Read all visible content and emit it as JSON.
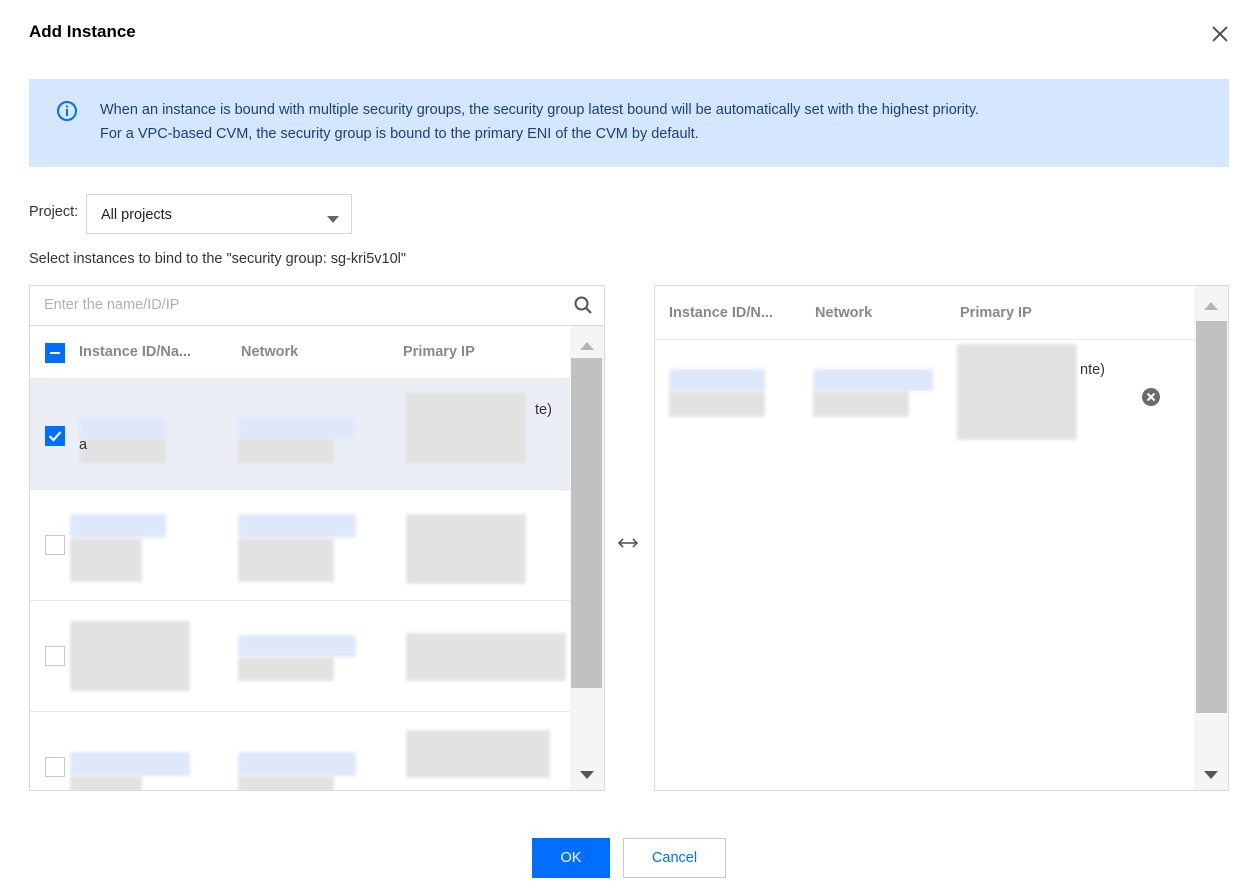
{
  "dialog": {
    "title": "Add Instance"
  },
  "notice": {
    "line1": "When an instance is bound with multiple security groups, the security group latest bound will be automatically set with the highest priority.",
    "line2": "For a VPC-based CVM, the security group is bound to the primary ENI of the CVM by default."
  },
  "project": {
    "label": "Project:",
    "selected": "All projects"
  },
  "instructions": "Select instances to bind to the \"security group: sg-kri5v10l\"",
  "left_panel": {
    "search_placeholder": "Enter the name/ID/IP",
    "columns": [
      "Instance ID/Na...",
      "Network",
      "Primary IP"
    ],
    "rows": [
      {
        "checked": true,
        "ip_suffix": "te)",
        "name_prefix": "a"
      },
      {
        "checked": false
      },
      {
        "checked": false
      },
      {
        "checked": false
      }
    ]
  },
  "right_panel": {
    "columns": [
      "Instance ID/N...",
      "Network",
      "Primary IP"
    ],
    "rows": [
      {
        "ip_suffix": "nte)"
      }
    ]
  },
  "buttons": {
    "ok": "OK",
    "cancel": "Cancel"
  },
  "colors": {
    "accent": "#006eff",
    "notice_bg": "#d5e7ff",
    "notice_text": "#1a3f7a",
    "selected_row_bg": "#ebeef5"
  },
  "icons": {
    "close": "close-icon",
    "info": "info-icon",
    "search": "search-icon",
    "swap": "swap-arrows-icon",
    "remove": "remove-circle-icon"
  }
}
